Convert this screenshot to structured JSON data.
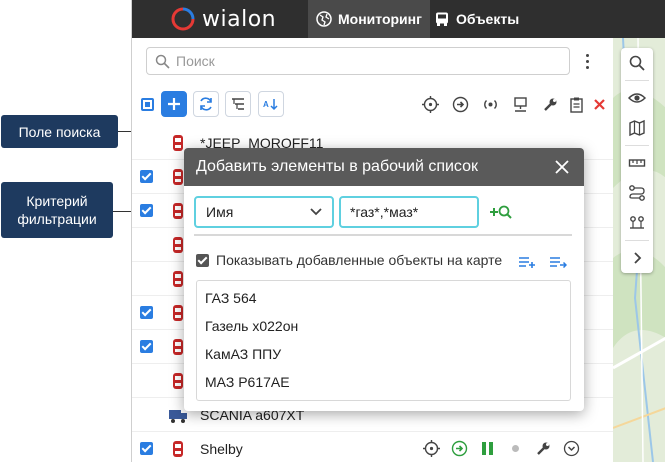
{
  "callouts": {
    "search_field": "Поле поиска",
    "filter_criterion": "Критерий фильтрации"
  },
  "header": {
    "logo_text": "wialon",
    "tabs": [
      {
        "label": "Мониторинг",
        "icon": "globe-icon",
        "active": true
      },
      {
        "label": "Объекты",
        "icon": "bus-icon",
        "active": false
      }
    ]
  },
  "panel": {
    "search_placeholder": "Поиск",
    "rows": [
      {
        "name": "*JEEP_MOROFF11",
        "checked": false,
        "icon": "car-icon"
      },
      {
        "name": "",
        "checked": true,
        "icon": "car-icon"
      },
      {
        "name": "",
        "checked": true,
        "icon": "car-icon"
      },
      {
        "name": "",
        "checked": false,
        "icon": "car-icon"
      },
      {
        "name": "",
        "checked": false,
        "icon": "car-icon"
      },
      {
        "name": "",
        "checked": true,
        "icon": "car-icon"
      },
      {
        "name": "",
        "checked": true,
        "icon": "car-icon"
      },
      {
        "name": "",
        "checked": false,
        "icon": "car-icon"
      },
      {
        "name": "SCANIA a607XT",
        "checked": false,
        "icon": "truck-icon"
      },
      {
        "name": "Shelby",
        "checked": true,
        "icon": "car-icon"
      }
    ]
  },
  "dialog": {
    "title": "Добавить элементы в рабочий список",
    "criterion": "Имя",
    "mask": "*газ*,*маз*",
    "show_on_map_label": "Показывать добавленные объекты на карте",
    "show_on_map_checked": true,
    "results": [
      "ГАЗ 564",
      "Газель х022он",
      "КамАЗ ППУ",
      "МАЗ Р617АЕ"
    ]
  },
  "colors": {
    "accent": "#2a7de1",
    "callout_bg": "#1e3a5f",
    "dialog_header": "#5a5a5a",
    "field_focus": "#5fd0e0",
    "delete_red": "#e53935",
    "ok_green": "#2e9e3e"
  }
}
